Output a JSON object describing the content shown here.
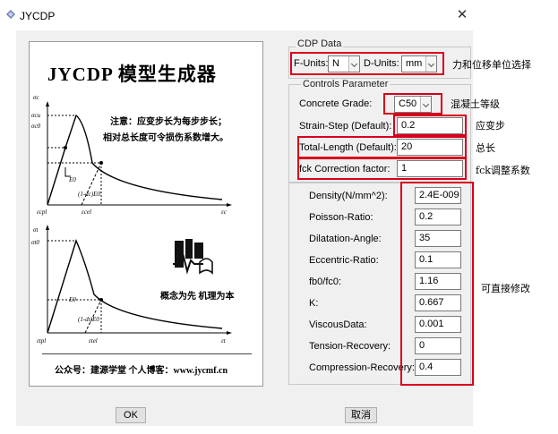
{
  "window": {
    "title": "JYCDP",
    "close_glyph": "✕"
  },
  "image_panel": {
    "title": "JYCDP 模型生成器",
    "note_line1": "注意：应变步长为每步步长；",
    "note_line2": "相对总长度可令损伤系数增大。",
    "slogan": "概念为先  机理为本",
    "footer": "公众号：建源学堂   个人博客：www.jycmf.cn",
    "plot1_labels": {
      "sigma_c": "σc",
      "sigma_cu": "σcu",
      "sigma_c0": "σc0",
      "E0": "E0",
      "one_minus_dc_E0": "(1-dc)E0",
      "eps_pl": "εcpl",
      "eps_el": "εcel",
      "eps_c": "εc"
    },
    "plot2_labels": {
      "sigma_t": "σt",
      "sigma_t0": "σt0",
      "E0": "E0",
      "one_minus_dt_E0": "(1-dt)E0",
      "eps_pl": "εtpl",
      "eps_el": "εtel",
      "eps_t": "εt"
    }
  },
  "cdp_data": {
    "group_title": "CDP Data",
    "f_units_label": "F-Units:",
    "f_units_value": "N",
    "d_units_label": "D-Units:",
    "d_units_value": "mm"
  },
  "controls": {
    "group_title": "Controls Parameter",
    "concrete_grade_label": "Concrete Grade:",
    "concrete_grade_value": "C50",
    "strain_step_label": "Strain-Step (Default):",
    "strain_step_value": "0.2",
    "total_length_label": "Total-Length (Default):",
    "total_length_value": "20",
    "fck_label": "fck Correction factor:",
    "fck_value": "1"
  },
  "params": [
    {
      "label": "Density(N/mm^2):",
      "value": "2.4E-009"
    },
    {
      "label": "Poisson-Ratio:",
      "value": "0.2"
    },
    {
      "label": "Dilatation-Angle:",
      "value": "35"
    },
    {
      "label": "Eccentric-Ratio:",
      "value": "0.1"
    },
    {
      "label": "fb0/fc0:",
      "value": "1.16"
    },
    {
      "label": "K:",
      "value": "0.667"
    },
    {
      "label": "ViscousData:",
      "value": "0.001"
    },
    {
      "label": "Tension-Recovery:",
      "value": "0"
    },
    {
      "label": "Compression-Recovery:",
      "value": "0.4"
    }
  ],
  "annotations": {
    "units": "力和位移单位选择",
    "grade": "混凝土等级",
    "strain": "应变步",
    "total": "总长",
    "fck": "fck调整系数",
    "editable": "可直接修改"
  },
  "buttons": {
    "ok": "OK",
    "cancel": "取消"
  },
  "colors": {
    "highlight_red": "#d9001b",
    "dialog_bg": "#f0f0f0"
  },
  "icons": {
    "app": "jycdp-app-icon",
    "close": "close-icon",
    "logo": "jycdp-logo"
  }
}
